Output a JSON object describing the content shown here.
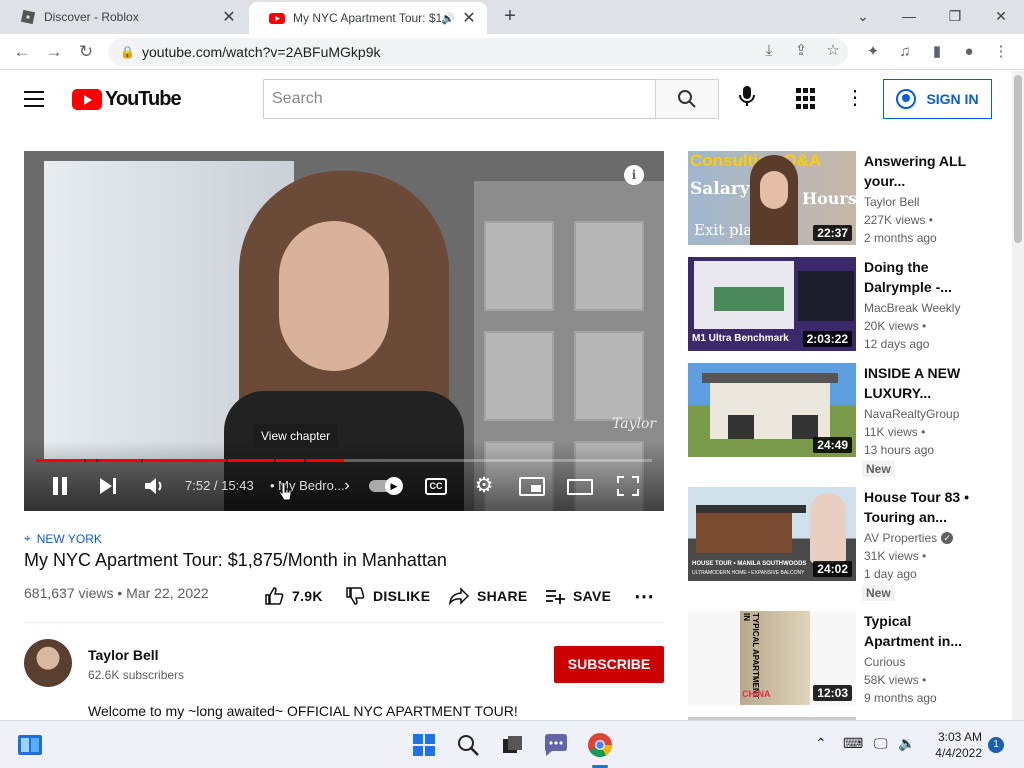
{
  "browser": {
    "tabs": [
      {
        "title": "Discover - Roblox",
        "active": false
      },
      {
        "title": "My NYC Apartment Tour: $1",
        "active": true
      }
    ],
    "url": "youtube.com/watch?v=2ABFuMGkp9k"
  },
  "header": {
    "logo_text": "YouTube",
    "search_placeholder": "Search",
    "signin_label": "SIGN IN"
  },
  "player": {
    "tooltip": "View chapter",
    "time": "7:52 / 15:43",
    "chapter": "• My Bedro...",
    "progress_fraction": 0.5,
    "cc_label": "CC",
    "signature": "Taylor"
  },
  "video": {
    "location_tag": "NEW YORK",
    "title": "My NYC Apartment Tour: $1,875/Month in Manhattan",
    "meta": "681,637 views • Mar 22, 2022",
    "likes": "7.9K",
    "dislike_label": "DISLIKE",
    "share_label": "SHARE",
    "save_label": "SAVE"
  },
  "channel": {
    "name": "Taylor Bell",
    "subscribers": "62.6K subscribers",
    "subscribe_label": "SUBSCRIBE",
    "description": "Welcome to my ~long awaited~ OFFICIAL NYC APARTMENT TOUR!"
  },
  "related": [
    {
      "title": "Answering ALL your...",
      "channel": "Taylor Bell",
      "views": "227K views •",
      "age": "2 months ago",
      "duration": "22:37",
      "thumb_text": [
        "Consulting Q&A",
        "Salary",
        "Hours",
        "Exit plan"
      ],
      "badge": "",
      "verified": false
    },
    {
      "title": "Doing the Dalrymple -...",
      "channel": "MacBreak Weekly",
      "views": "20K views •",
      "age": "12 days ago",
      "duration": "2:03:22",
      "thumb_text": [
        "M1 Ultra Benchmark"
      ],
      "badge": "",
      "verified": false
    },
    {
      "title": "INSIDE A NEW LUXURY...",
      "channel": "NavaRealtyGroup",
      "views": "11K views •",
      "age": "13 hours ago",
      "duration": "24:49",
      "thumb_text": [],
      "badge": "New",
      "verified": false
    },
    {
      "title": "House Tour 83 • Touring an...",
      "channel": "AV Properties",
      "views": "31K views •",
      "age": "1 day ago",
      "duration": "24:02",
      "thumb_text": [
        "HOUSE TOUR • MANILA SOUTHWOODS",
        "ULTRAMODERN HOME • EXPANSIVE BALCONY"
      ],
      "badge": "New",
      "verified": true
    },
    {
      "title": "Typical Apartment in...",
      "channel": "Curious",
      "views": "58K views •",
      "age": "9 months ago",
      "duration": "12:03",
      "thumb_text": [
        "TYPICAL APARTMENT IN",
        "CHINA"
      ],
      "badge": "",
      "verified": false
    }
  ],
  "taskbar": {
    "time": "3:03 AM",
    "date": "4/4/2022",
    "notifications": "1"
  },
  "colors": {
    "youtube_red": "#ff0000",
    "subscribe_red": "#cc0000",
    "link_blue": "#065fd4"
  }
}
